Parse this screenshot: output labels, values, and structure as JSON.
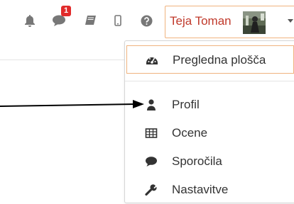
{
  "topbar": {
    "notification_count": "1",
    "user_name": "Teja Toman",
    "icons": [
      "bell-icon",
      "chat-bubble-icon",
      "book-icon",
      "mobile-icon",
      "help-icon"
    ]
  },
  "user_menu": {
    "items": [
      {
        "label": "Pregledna plošča",
        "icon": "dashboard-icon"
      },
      {
        "label": "Profil",
        "icon": "user-icon"
      },
      {
        "label": "Ocene",
        "icon": "grades-table-icon"
      },
      {
        "label": "Sporočila",
        "icon": "message-bubble-icon"
      },
      {
        "label": "Nastavitve",
        "icon": "wrench-icon"
      }
    ]
  },
  "colors": {
    "accent_border": "#f0b37e",
    "user_name": "#c0392b",
    "badge": "#e12b2b"
  }
}
